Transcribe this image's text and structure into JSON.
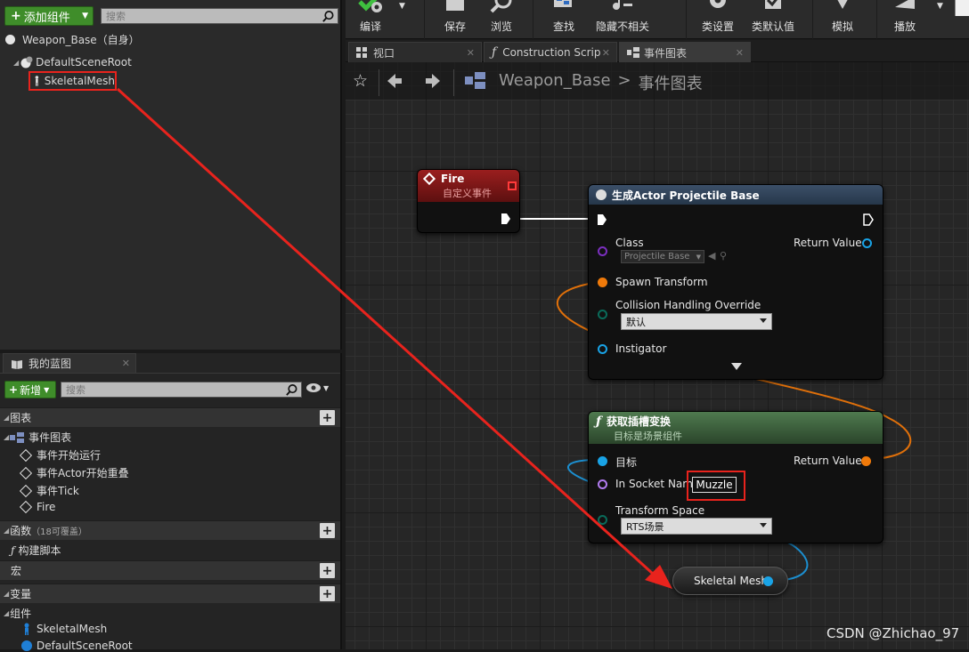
{
  "components": {
    "add_label": "添加组件",
    "search_placeholder": "搜索",
    "self_item": "Weapon_Base（自身）",
    "tree": [
      {
        "label": "DefaultSceneRoot"
      },
      {
        "label": "SkeletalMesh"
      }
    ]
  },
  "my_blueprint": {
    "tab_label": "我的蓝图",
    "new_label": "新增",
    "search_placeholder": "搜索",
    "graphs_header": "图表",
    "event_graph": "事件图表",
    "events": [
      "事件开始运行",
      "事件Actor开始重叠",
      "事件Tick",
      "Fire"
    ],
    "functions_header": "函数",
    "functions_note": "（18可覆盖）",
    "construction_script": "构建脚本",
    "macros_header": "宏",
    "variables_header": "变量",
    "components_header": "组件",
    "component_items": [
      "SkeletalMesh",
      "DefaultSceneRoot"
    ]
  },
  "toolbar": {
    "items": [
      "编译",
      "保存",
      "浏览",
      "查找",
      "隐藏不相关",
      "类设置",
      "类默认值",
      "模拟",
      "播放"
    ]
  },
  "tabs": [
    {
      "label": "视口",
      "icon": "viewport-icon"
    },
    {
      "label": "Construction Scrip",
      "icon": "function-icon"
    },
    {
      "label": "事件图表",
      "icon": "event-graph-icon"
    }
  ],
  "breadcrumb": {
    "blueprint": "Weapon_Base",
    "separator": ">",
    "graph": "事件图表"
  },
  "nodes": {
    "fire": {
      "title": "Fire",
      "subtitle": "自定义事件"
    },
    "spawn": {
      "title": "生成Actor Projectile Base",
      "class_label": "Class",
      "class_value": "Projectile Base",
      "return_label": "Return Value",
      "spawn_transform": "Spawn Transform",
      "collision_label": "Collision Handling Override",
      "collision_value": "默认",
      "instigator": "Instigator"
    },
    "socket": {
      "title": "获取插槽变换",
      "subtitle": "目标是场景组件",
      "target": "目标",
      "return_label": "Return Value",
      "socket_name_label": "In Socket Name",
      "socket_name_value": "Muzzle",
      "transform_space_label": "Transform Space",
      "transform_space_value": "RTS场景"
    },
    "mesh_var": {
      "label": "Skeletal Mesh"
    }
  },
  "colors": {
    "highlight": "#e8231d",
    "event_header": "#8c1a1a",
    "function_header": "#2e4d2e",
    "exec_wire": "#ffffff",
    "object_pin": "#19a3e6",
    "struct_pin": "#f07a0a",
    "name_pin": "#b27cf0",
    "enum_pin": "#0a6b5a"
  },
  "watermark": "CSDN @Zhichao_97"
}
